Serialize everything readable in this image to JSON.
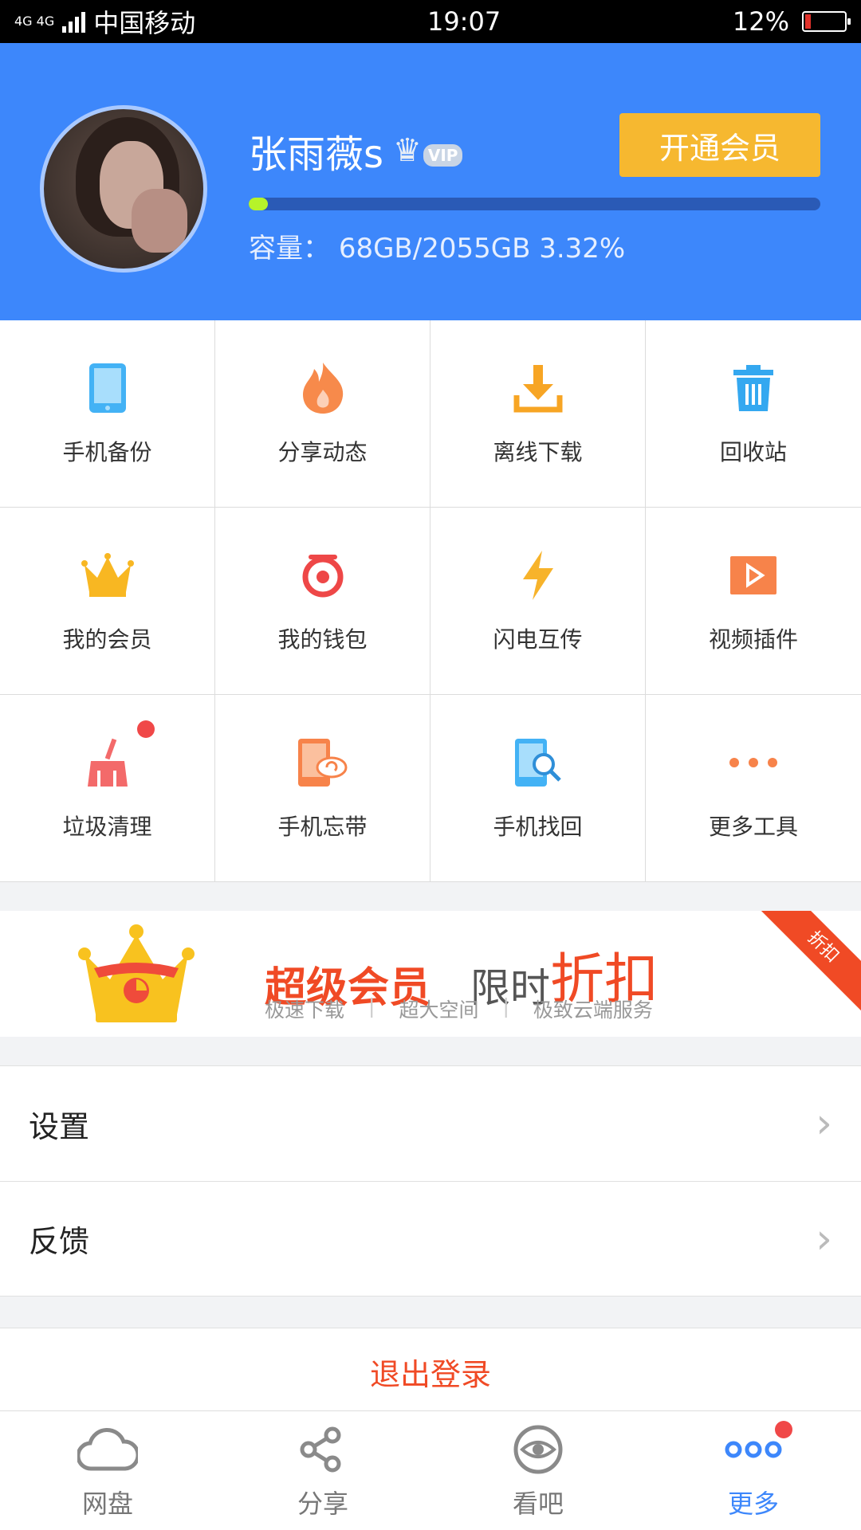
{
  "status_bar": {
    "network": "4G 4G",
    "carrier": "中国移动",
    "time": "19:07",
    "battery": "12%"
  },
  "profile": {
    "username": "张雨薇s",
    "vip_label": "VIP",
    "vip_button": "开通会员",
    "capacity_label": "容量：",
    "capacity_value": "68GB/2055GB 3.32%",
    "usage_fraction": 0.0332
  },
  "tools": [
    {
      "label": "手机备份",
      "icon": "tablet-icon"
    },
    {
      "label": "分享动态",
      "icon": "flame-icon"
    },
    {
      "label": "离线下载",
      "icon": "download-icon"
    },
    {
      "label": "回收站",
      "icon": "trash-icon"
    },
    {
      "label": "我的会员",
      "icon": "crown-icon"
    },
    {
      "label": "我的钱包",
      "icon": "wallet-icon"
    },
    {
      "label": "闪电互传",
      "icon": "lightning-icon"
    },
    {
      "label": "视频插件",
      "icon": "video-play-icon"
    },
    {
      "label": "垃圾清理",
      "icon": "broom-icon"
    },
    {
      "label": "手机忘带",
      "icon": "phone-cloud-icon"
    },
    {
      "label": "手机找回",
      "icon": "phone-search-icon"
    },
    {
      "label": "更多工具",
      "icon": "more-dots-icon"
    }
  ],
  "banner": {
    "title": "超级会员",
    "subtitle_prefix": "限时",
    "subtitle_highlight": "折扣",
    "features": [
      "极速下载",
      "超大空间",
      "极致云端服务"
    ],
    "ribbon": "折扣"
  },
  "menu": {
    "settings": "设置",
    "feedback": "反馈"
  },
  "logout": "退出登录",
  "bottom_nav": [
    {
      "label": "网盘",
      "icon": "cloud-icon"
    },
    {
      "label": "分享",
      "icon": "share-icon"
    },
    {
      "label": "看吧",
      "icon": "eye-icon"
    },
    {
      "label": "更多",
      "icon": "more-dots-icon",
      "active": true
    }
  ],
  "colors": {
    "header_bg": "#3d87fb",
    "vip_button": "#f6b830",
    "accent_red": "#f04a25",
    "active_nav": "#3d87fb"
  }
}
